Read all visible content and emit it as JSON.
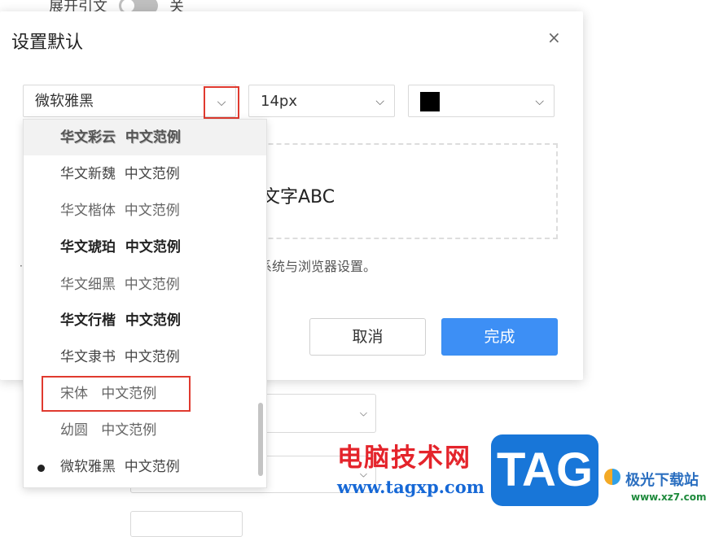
{
  "background": {
    "top_label": "展开引文",
    "toggle_state": "关"
  },
  "dialog": {
    "title": "设置默认",
    "close_glyph": "×",
    "font_select": {
      "value": "微软雅黑",
      "chevron": "⌵"
    },
    "size_select": {
      "value": "14px",
      "chevron": "⌵"
    },
    "color_select": {
      "color": "#000000",
      "chevron": "⌵"
    },
    "preview_text": "文字ABC",
    "hint_text": "系统与浏览器设置。",
    "cancel_label": "取消",
    "confirm_label": "完成"
  },
  "font_options": [
    {
      "label": "华文彩云  中文范例",
      "style": "shadow",
      "state": "hover"
    },
    {
      "label": "华文新魏  中文范例",
      "style": "serif"
    },
    {
      "label": "华文楷体  中文范例",
      "style": "serif"
    },
    {
      "label": "华文琥珀  中文范例",
      "style": "bold"
    },
    {
      "label": "华文细黑  中文范例",
      "style": "light"
    },
    {
      "label": "华文行楷  中文范例",
      "style": "bold serif"
    },
    {
      "label": "华文隶书  中文范例",
      "style": "serif"
    },
    {
      "label": "宋体   中文范例",
      "style": "serif",
      "highlighted": true
    },
    {
      "label": "幼圆   中文范例",
      "style": "light"
    },
    {
      "label": "微软雅黑  中文范例",
      "style": "",
      "selected": true
    }
  ],
  "watermark": {
    "cn_text": "电脑技术网",
    "url_text": "www.tagxp.com",
    "badge_text": "TAG",
    "site_name": "极光下载站",
    "site_url": "www.xz7.com"
  },
  "colors": {
    "accent_blue": "#3d8ff5",
    "highlight_red": "#e03a2f"
  }
}
